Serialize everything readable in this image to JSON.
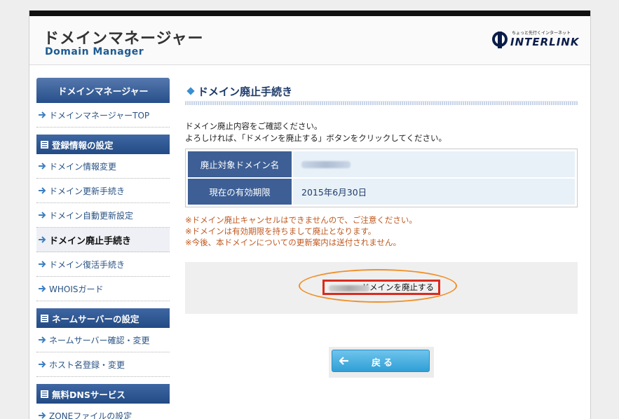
{
  "header": {
    "title_jp": "ドメインマネージャー",
    "title_en": "Domain Manager",
    "brand_tagline": "ちょっと先行くインターネット",
    "brand_name": "INTERLINK"
  },
  "sidebar": {
    "title": "ドメインマネージャー",
    "top_item": "ドメインマネージャーTOP",
    "sections": [
      {
        "title": "登録情報の設定",
        "items": [
          "ドメイン情報変更",
          "ドメイン更新手続き",
          "ドメイン自動更新設定",
          "ドメイン廃止手続き",
          "ドメイン復活手続き",
          "WHOISガード"
        ]
      },
      {
        "title": "ネームサーバーの設定",
        "items": [
          "ネームサーバー確認・変更",
          "ホスト名登録・変更"
        ]
      },
      {
        "title": "無料DNSサービス",
        "items": [
          "ZONEファイルの設定"
        ]
      }
    ],
    "active_item": "ドメイン廃止手続き"
  },
  "main": {
    "title": "ドメイン廃止手続き",
    "intro_line1": "ドメイン廃止内容をご確認ください。",
    "intro_line2": "よろしければ、「ドメインを廃止する」ボタンをクリックしてください。",
    "table": {
      "row1_label": "廃止対象ドメイン名",
      "row2_label": "現在の有効期限",
      "row2_value": "2015年6月30日"
    },
    "notes": [
      "※ドメイン廃止キャンセルはできませんので、ご注意ください。",
      "※ドメインは有効期限を持ちまして廃止となります。",
      "※今後、本ドメインについての更新案内は送付されません。"
    ],
    "abolish_button": "ドメインを廃止する",
    "back_button": "戻る"
  },
  "colors": {
    "accent_navy": "#274f8a",
    "note_orange": "#c0581f",
    "highlight_ring": "#f0902a",
    "button_border": "#d92b1d",
    "back_blue": "#2f9fd6"
  }
}
